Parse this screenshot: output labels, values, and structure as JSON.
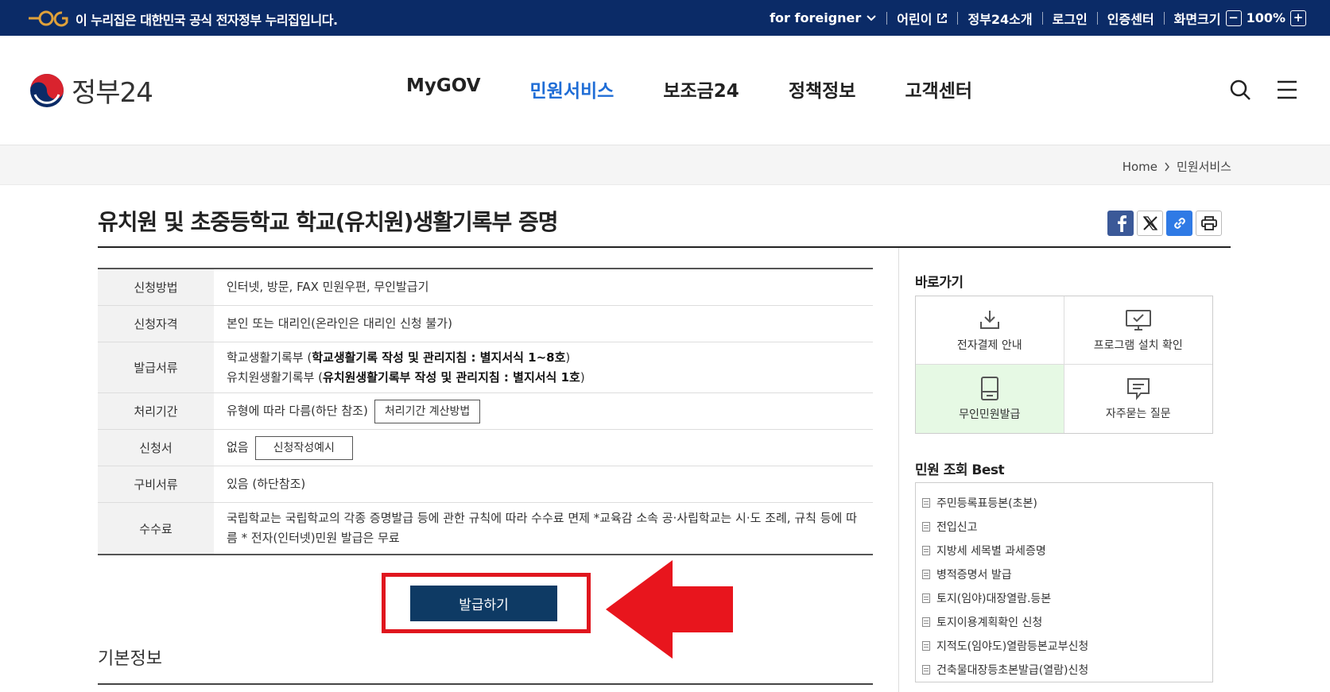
{
  "topbar": {
    "gov_notice": "이 누리집은 대한민국 공식 전자정부 누리집입니다.",
    "for_foreigner": "for foreigner",
    "kids": "어린이",
    "about": "정부24소개",
    "login": "로그인",
    "cert_center": "인증센터",
    "screen_size": "화면크기",
    "zoom_minus": "−",
    "zoom_level": "100%",
    "zoom_plus": "+"
  },
  "header": {
    "logo_text": "정부24",
    "nav": [
      "MyGOV",
      "민원서비스",
      "보조금24",
      "정책정보",
      "고객센터"
    ],
    "active_nav": "민원서비스"
  },
  "breadcrumb": {
    "home": "Home",
    "current": "민원서비스"
  },
  "page": {
    "title": "유치원 및 초중등학교 학교(유치원)생활기록부 증명",
    "issue_button": "발급하기",
    "section_title": "기본정보"
  },
  "info": {
    "method_label": "신청방법",
    "method_value": "인터넷, 방문, FAX 민원우편, 무인발급기",
    "eligibility_label": "신청자격",
    "eligibility_value": "본인 또는 대리인(온라인은 대리인 신청 불가)",
    "docs_label": "발급서류",
    "docs_line1_prefix": "학교생활기록부 (",
    "docs_line1_bold": "학교생활기록 작성 및 관리지침 : 별지서식 1~8호",
    "docs_line1_suffix": ")",
    "docs_line2_prefix": "유치원생활기록부 (",
    "docs_line2_bold": "유치원생활기록부 작성 및 관리지침 : 별지서식 1호",
    "docs_line2_suffix": ")",
    "period_label": "처리기간",
    "period_value": "유형에 따라 다름(하단 참조)",
    "period_button": "처리기간 계산방법",
    "form_label": "신청서",
    "form_value": "없음",
    "form_button": "신청작성예시",
    "required_label": "구비서류",
    "required_value": "있음 (하단참조)",
    "fee_label": "수수료",
    "fee_value": "국립학교는 국립학교의 각종 증명발급 등에 관한 규칙에 따라 수수료 면제 *교육감 소속 공·사립학교는 시·도 조례, 규칙 등에 따름 * 전자(인터넷)민원 발급은 무료"
  },
  "sidebar": {
    "quick_title": "바로가기",
    "quick_items": [
      "전자결제 안내",
      "프로그램 설치 확인",
      "무인민원발급",
      "자주묻는 질문"
    ],
    "best_title": "민원 조회 Best",
    "best_items": [
      "주민등록표등본(초본)",
      "전입신고",
      "지방세 세목별 과세증명",
      "병적증명서 발급",
      "토지(임야)대장열람.등본",
      "토지이용계획확인 신청",
      "지적도(임야도)열람등본교부신청",
      "건축물대장등초본발급(열람)신청"
    ]
  },
  "colors": {
    "topbar": "#0b2b67",
    "accent": "#1f6dd6",
    "issue_button": "#0e3a64",
    "annotation_red": "#e0161e"
  }
}
